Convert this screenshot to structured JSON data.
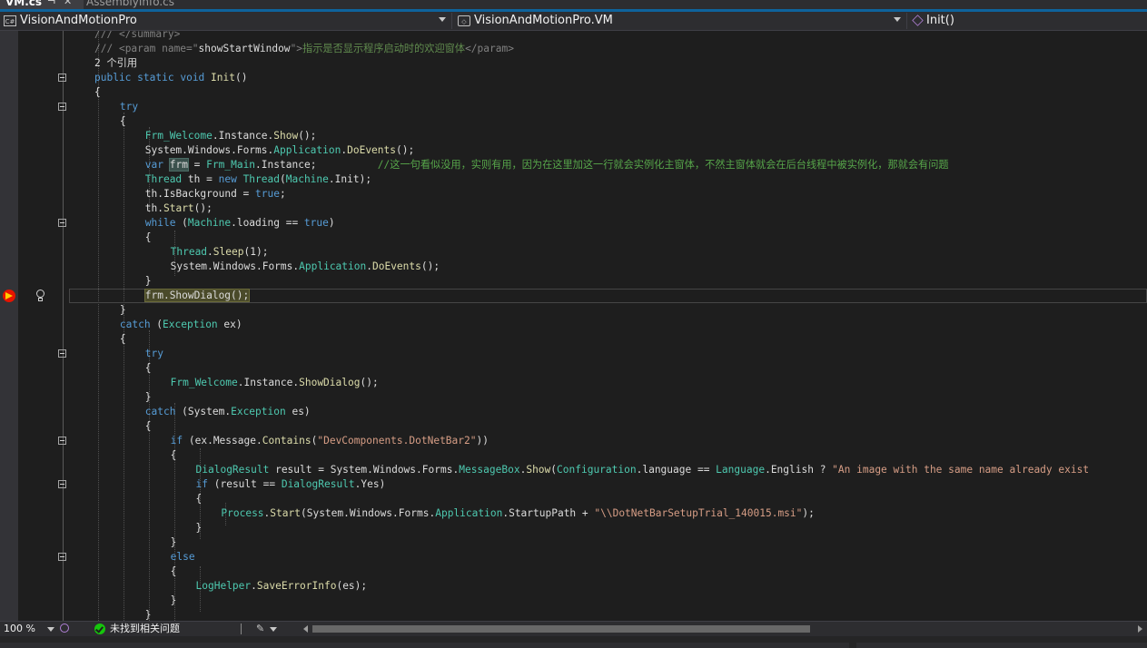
{
  "tabs": [
    {
      "label": "VM.cs",
      "active": true
    },
    {
      "label": "AssemblyInfo.cs",
      "active": false
    }
  ],
  "navbar": {
    "project": "VisionAndMotionPro",
    "project_icon": "C#",
    "type": "VisionAndMotionPro.VM",
    "member": "Init()"
  },
  "code": [
    {
      "indent": 4,
      "fold": false,
      "tokens": [
        [
          "xt",
          "/// "
        ],
        [
          "xt",
          "</summary>"
        ]
      ]
    },
    {
      "indent": 4,
      "fold": false,
      "tokens": [
        [
          "xt",
          "/// "
        ],
        [
          "xt",
          "<param name=\""
        ],
        [
          "pl",
          "showStartWindow"
        ],
        [
          "xt",
          "\">"
        ],
        [
          "xd",
          "指示是否显示程序启动时的欢迎窗体"
        ],
        [
          "xt",
          "</param>"
        ]
      ]
    },
    {
      "indent": 4,
      "fold": false,
      "tokens": [
        [
          "rf",
          "2 个引用"
        ]
      ]
    },
    {
      "indent": 4,
      "fold": true,
      "tokens": [
        [
          "kw",
          "public"
        ],
        [
          "pl",
          " "
        ],
        [
          "kw",
          "static"
        ],
        [
          "pl",
          " "
        ],
        [
          "kw",
          "void"
        ],
        [
          "pl",
          " "
        ],
        [
          "me",
          "Init"
        ],
        [
          "pl",
          "()"
        ]
      ]
    },
    {
      "indent": 4,
      "fold": false,
      "tokens": [
        [
          "pl",
          "{"
        ]
      ]
    },
    {
      "indent": 8,
      "fold": true,
      "tokens": [
        [
          "kw",
          "try"
        ]
      ]
    },
    {
      "indent": 8,
      "fold": false,
      "tokens": [
        [
          "pl",
          "{"
        ]
      ]
    },
    {
      "indent": 12,
      "fold": false,
      "tokens": [
        [
          "ty",
          "Frm_Welcome"
        ],
        [
          "pl",
          "."
        ],
        [
          "pl",
          "Instance"
        ],
        [
          "pl",
          "."
        ],
        [
          "me",
          "Show"
        ],
        [
          "pl",
          "();"
        ]
      ]
    },
    {
      "indent": 12,
      "fold": false,
      "tokens": [
        [
          "pl",
          "System"
        ],
        [
          "pl",
          "."
        ],
        [
          "pl",
          "Windows"
        ],
        [
          "pl",
          "."
        ],
        [
          "pl",
          "Forms"
        ],
        [
          "pl",
          "."
        ],
        [
          "ty",
          "Application"
        ],
        [
          "pl",
          "."
        ],
        [
          "me",
          "DoEvents"
        ],
        [
          "pl",
          "();"
        ]
      ]
    },
    {
      "indent": 12,
      "fold": false,
      "tokens": [
        [
          "kw",
          "var"
        ],
        [
          "pl",
          " "
        ],
        [
          "hv",
          "frm"
        ],
        [
          "pl",
          " = "
        ],
        [
          "ty",
          "Frm_Main"
        ],
        [
          "pl",
          "."
        ],
        [
          "pl",
          "Instance"
        ],
        [
          "pl",
          ";          "
        ],
        [
          "cm",
          "//这一句看似没用，实则有用，因为在这里加这一行就会实例化主窗体，不然主窗体就会在后台线程中被实例化，那就会有问题"
        ]
      ]
    },
    {
      "indent": 12,
      "fold": false,
      "tokens": [
        [
          "ty",
          "Thread"
        ],
        [
          "pl",
          " th = "
        ],
        [
          "kw",
          "new"
        ],
        [
          "pl",
          " "
        ],
        [
          "ty",
          "Thread"
        ],
        [
          "pl",
          "("
        ],
        [
          "ty",
          "Machine"
        ],
        [
          "pl",
          "."
        ],
        [
          "pl",
          "Init"
        ],
        [
          "pl",
          ");"
        ]
      ]
    },
    {
      "indent": 12,
      "fold": false,
      "tokens": [
        [
          "pl",
          "th"
        ],
        [
          "pl",
          "."
        ],
        [
          "pl",
          "IsBackground = "
        ],
        [
          "kw",
          "true"
        ],
        [
          "pl",
          ";"
        ]
      ]
    },
    {
      "indent": 12,
      "fold": false,
      "tokens": [
        [
          "pl",
          "th"
        ],
        [
          "pl",
          "."
        ],
        [
          "me",
          "Start"
        ],
        [
          "pl",
          "();"
        ]
      ]
    },
    {
      "indent": 12,
      "fold": true,
      "tokens": [
        [
          "kw",
          "while"
        ],
        [
          "pl",
          " ("
        ],
        [
          "ty",
          "Machine"
        ],
        [
          "pl",
          "."
        ],
        [
          "pl",
          "loading == "
        ],
        [
          "kw",
          "true"
        ],
        [
          "pl",
          ")"
        ]
      ]
    },
    {
      "indent": 12,
      "fold": false,
      "tokens": [
        [
          "pl",
          "{"
        ]
      ]
    },
    {
      "indent": 16,
      "fold": false,
      "tokens": [
        [
          "ty",
          "Thread"
        ],
        [
          "pl",
          "."
        ],
        [
          "me",
          "Sleep"
        ],
        [
          "pl",
          "(1);"
        ]
      ]
    },
    {
      "indent": 16,
      "fold": false,
      "tokens": [
        [
          "pl",
          "System"
        ],
        [
          "pl",
          "."
        ],
        [
          "pl",
          "Windows"
        ],
        [
          "pl",
          "."
        ],
        [
          "pl",
          "Forms"
        ],
        [
          "pl",
          "."
        ],
        [
          "ty",
          "Application"
        ],
        [
          "pl",
          "."
        ],
        [
          "me",
          "DoEvents"
        ],
        [
          "pl",
          "();"
        ]
      ]
    },
    {
      "indent": 12,
      "fold": false,
      "tokens": [
        [
          "pl",
          "}"
        ]
      ]
    },
    {
      "indent": 12,
      "fold": false,
      "current": true,
      "tokens": [
        [
          "hc",
          "frm.ShowDialog();"
        ]
      ]
    },
    {
      "indent": 8,
      "fold": false,
      "tokens": [
        [
          "pl",
          "}"
        ]
      ]
    },
    {
      "indent": 8,
      "fold": false,
      "tokens": [
        [
          "kw",
          "catch"
        ],
        [
          "pl",
          " ("
        ],
        [
          "ty",
          "Exception"
        ],
        [
          "pl",
          " ex)"
        ]
      ]
    },
    {
      "indent": 8,
      "fold": false,
      "tokens": [
        [
          "pl",
          "{"
        ]
      ]
    },
    {
      "indent": 12,
      "fold": true,
      "tokens": [
        [
          "kw",
          "try"
        ]
      ]
    },
    {
      "indent": 12,
      "fold": false,
      "tokens": [
        [
          "pl",
          "{"
        ]
      ]
    },
    {
      "indent": 16,
      "fold": false,
      "tokens": [
        [
          "ty",
          "Frm_Welcome"
        ],
        [
          "pl",
          "."
        ],
        [
          "pl",
          "Instance"
        ],
        [
          "pl",
          "."
        ],
        [
          "me",
          "ShowDialog"
        ],
        [
          "pl",
          "();"
        ]
      ]
    },
    {
      "indent": 12,
      "fold": false,
      "tokens": [
        [
          "pl",
          "}"
        ]
      ]
    },
    {
      "indent": 12,
      "fold": false,
      "tokens": [
        [
          "kw",
          "catch"
        ],
        [
          "pl",
          " ("
        ],
        [
          "pl",
          "System"
        ],
        [
          "pl",
          "."
        ],
        [
          "ty",
          "Exception"
        ],
        [
          "pl",
          " es)"
        ]
      ]
    },
    {
      "indent": 12,
      "fold": false,
      "tokens": [
        [
          "pl",
          "{"
        ]
      ]
    },
    {
      "indent": 16,
      "fold": true,
      "tokens": [
        [
          "kw",
          "if"
        ],
        [
          "pl",
          " (ex"
        ],
        [
          "pl",
          "."
        ],
        [
          "pl",
          "Message"
        ],
        [
          "pl",
          "."
        ],
        [
          "me",
          "Contains"
        ],
        [
          "pl",
          "("
        ],
        [
          "st",
          "\"DevComponents.DotNetBar2\""
        ],
        [
          "pl",
          "))"
        ]
      ]
    },
    {
      "indent": 16,
      "fold": false,
      "tokens": [
        [
          "pl",
          "{"
        ]
      ]
    },
    {
      "indent": 20,
      "fold": false,
      "tokens": [
        [
          "ty",
          "DialogResult"
        ],
        [
          "pl",
          " result = "
        ],
        [
          "pl",
          "System"
        ],
        [
          "pl",
          "."
        ],
        [
          "pl",
          "Windows"
        ],
        [
          "pl",
          "."
        ],
        [
          "pl",
          "Forms"
        ],
        [
          "pl",
          "."
        ],
        [
          "ty",
          "MessageBox"
        ],
        [
          "pl",
          "."
        ],
        [
          "me",
          "Show"
        ],
        [
          "pl",
          "("
        ],
        [
          "ty",
          "Configuration"
        ],
        [
          "pl",
          "."
        ],
        [
          "pl",
          "language == "
        ],
        [
          "ty",
          "Language"
        ],
        [
          "pl",
          "."
        ],
        [
          "pl",
          "English ? "
        ],
        [
          "st",
          "\"An image with the same name already exist"
        ]
      ]
    },
    {
      "indent": 20,
      "fold": true,
      "tokens": [
        [
          "kw",
          "if"
        ],
        [
          "pl",
          " (result == "
        ],
        [
          "ty",
          "DialogResult"
        ],
        [
          "pl",
          "."
        ],
        [
          "pl",
          "Yes)"
        ]
      ]
    },
    {
      "indent": 20,
      "fold": false,
      "tokens": [
        [
          "pl",
          "{"
        ]
      ]
    },
    {
      "indent": 24,
      "fold": false,
      "tokens": [
        [
          "ty",
          "Process"
        ],
        [
          "pl",
          "."
        ],
        [
          "me",
          "Start"
        ],
        [
          "pl",
          "(System"
        ],
        [
          "pl",
          "."
        ],
        [
          "pl",
          "Windows"
        ],
        [
          "pl",
          "."
        ],
        [
          "pl",
          "Forms"
        ],
        [
          "pl",
          "."
        ],
        [
          "ty",
          "Application"
        ],
        [
          "pl",
          "."
        ],
        [
          "pl",
          "StartupPath + "
        ],
        [
          "st",
          "\"\\\\DotNetBarSetupTrial_140015.msi\""
        ],
        [
          "pl",
          ");"
        ]
      ]
    },
    {
      "indent": 20,
      "fold": false,
      "tokens": [
        [
          "pl",
          "}"
        ]
      ]
    },
    {
      "indent": 16,
      "fold": false,
      "tokens": [
        [
          "pl",
          "}"
        ]
      ]
    },
    {
      "indent": 16,
      "fold": true,
      "tokens": [
        [
          "kw",
          "else"
        ]
      ]
    },
    {
      "indent": 16,
      "fold": false,
      "tokens": [
        [
          "pl",
          "{"
        ]
      ]
    },
    {
      "indent": 20,
      "fold": false,
      "tokens": [
        [
          "ty",
          "LogHelper"
        ],
        [
          "pl",
          "."
        ],
        [
          "me",
          "SaveErrorInfo"
        ],
        [
          "pl",
          "(es);"
        ]
      ]
    },
    {
      "indent": 16,
      "fold": false,
      "tokens": [
        [
          "pl",
          "}"
        ]
      ]
    },
    {
      "indent": 12,
      "fold": false,
      "tokens": [
        [
          "pl",
          "}"
        ]
      ]
    }
  ],
  "statusbar": {
    "zoom": "100 %",
    "issues": "未找到相关问题"
  },
  "colors": {
    "editor_bg": "#1e1e1e",
    "keyword": "#569cd6",
    "type": "#4ec9b0",
    "method": "#dcdcaa",
    "string": "#d69d85",
    "comment": "#57a64a",
    "accent": "#0e639c"
  }
}
